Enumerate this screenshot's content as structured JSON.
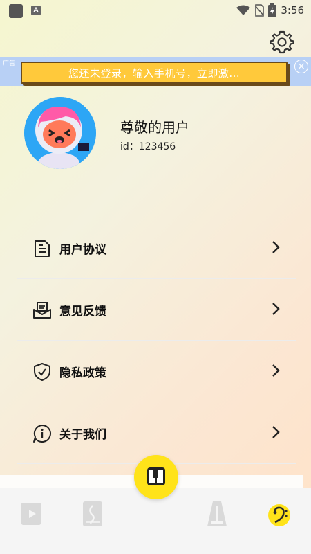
{
  "status_bar": {
    "time": "3:56",
    "notification_badge": "A"
  },
  "ad": {
    "label": "广告",
    "text": "您还未登录，输入手机号，立即激...",
    "close": "×"
  },
  "profile": {
    "name": "尊敬的用户",
    "id_text": "id：123456"
  },
  "menu": [
    {
      "label": "用户协议",
      "icon": "document-icon"
    },
    {
      "label": "意见反馈",
      "icon": "feedback-mail-icon"
    },
    {
      "label": "隐私政策",
      "icon": "shield-check-icon"
    },
    {
      "label": "关于我们",
      "icon": "info-icon"
    }
  ],
  "tabs": [
    {
      "icon": "video-play-icon",
      "active": false
    },
    {
      "icon": "music-book-icon",
      "active": false
    },
    {
      "icon": "piano-keys-icon",
      "active": false
    },
    {
      "icon": "metronome-icon",
      "active": false
    },
    {
      "icon": "bass-clef-icon",
      "active": true
    }
  ],
  "colors": {
    "accent_yellow": "#ffe31a",
    "ad_bg": "#b8d0f5",
    "ad_banner": "#ffc93b",
    "avatar_bg": "#2da6f5"
  }
}
